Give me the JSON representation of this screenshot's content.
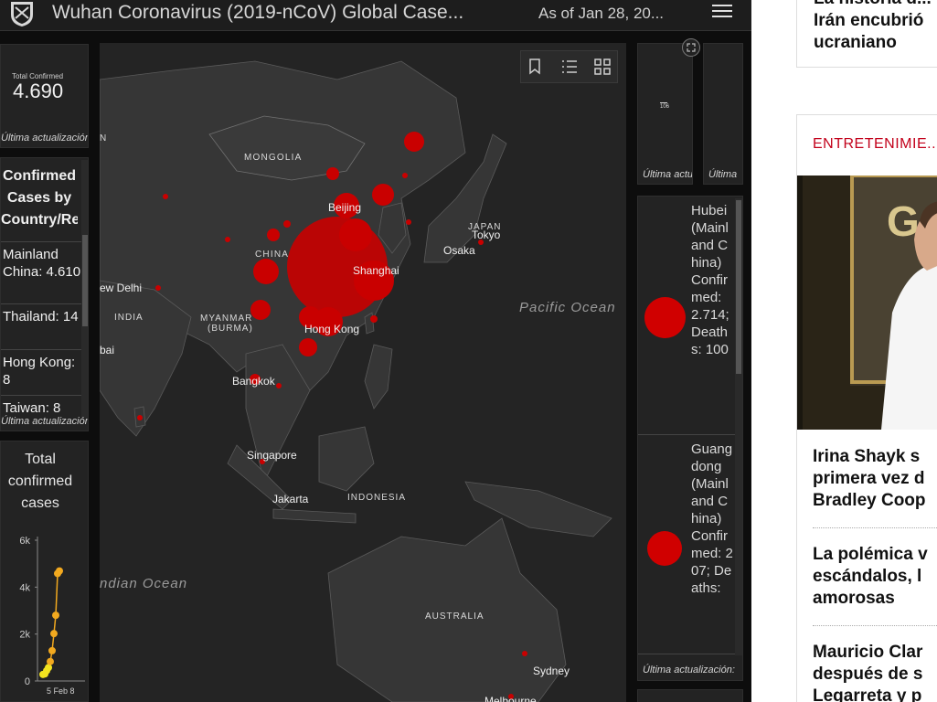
{
  "header": {
    "title": "Wuhan Coronavirus (2019-nCoV) Global Case...",
    "as_of": "As of Jan 28, 20..."
  },
  "total_confirmed": {
    "label": "Total Confirmed",
    "value": "4.690",
    "last_update": "Última actualización"
  },
  "by_country": {
    "heading": "Confirmed Cases by Country/Region",
    "items": [
      {
        "label": "Mainland China: 4.610"
      },
      {
        "label": "Thailand: 14"
      },
      {
        "label": "Hong Kong: 8"
      },
      {
        "label": "Taiwan: 8"
      }
    ],
    "last_update": "Última actualización"
  },
  "chart_panel": {
    "heading": "Total confirmed cases"
  },
  "chart_data": {
    "type": "line",
    "title": "Total confirmed cases",
    "xlabel": "",
    "ylabel": "",
    "ylim": [
      0,
      6000
    ],
    "yticks": [
      "0",
      "2k",
      "4k",
      "6k"
    ],
    "xtick_label": "5 Feb 8",
    "series": [
      {
        "values": [
          280,
          300,
          440,
          570,
          830,
          1290,
          2020,
          2800,
          4580,
          4690
        ]
      }
    ],
    "colors": {
      "points": "#f2a91f",
      "line": "#f2a91f",
      "highlight": "#f2e31f"
    }
  },
  "map": {
    "labels": {
      "mongolia": "MONGOLIA",
      "china": "CHINA",
      "beijing": "Beijing",
      "shanghai": "Shanghai",
      "japan": "JAPAN",
      "tokyo": "Tokyo",
      "osaka": "Osaka",
      "pacific": "Pacific Ocean",
      "new_delhi": "ew Delhi",
      "india": "INDIA",
      "myanmar": "MYANMAR",
      "burma": "(BURMA)",
      "hong_kong": "Hong Kong",
      "bai": "bai",
      "bangkok": "Bangkok",
      "singapore": "Singapore",
      "jakarta": "Jakarta",
      "indonesia": "INDONESIA",
      "indian_ocean": "ndian Ocean",
      "australia": "AUSTRALIA",
      "sydney": "Sydney",
      "melbourne": "Melbourne",
      "n_edge": "N"
    },
    "colors": {
      "case_dot": "#c90000",
      "land": "#363636",
      "water": "#242424",
      "border": "#707070"
    }
  },
  "right_top": {
    "value_label": "106",
    "last_update_1": "Última actu",
    "last_update_2": "Última"
  },
  "province_list": {
    "items": [
      {
        "name": "Hubei",
        "text": "Hubei (Mainland China) Confirmed: 2.714; Deaths: 100"
      },
      {
        "name": "Guangdong",
        "text": "Guangdong (Mainland China) Confirmed: 207; Deaths:"
      }
    ],
    "last_update": "Última actualización:"
  },
  "news": {
    "top_card": {
      "line1": "La historia d...",
      "line2": "Irán encubrió",
      "line3": "ucraniano"
    },
    "section": "ENTRETENIMIE...",
    "headlines": [
      {
        "l1": "Irina Shayk s",
        "l2": "primera vez d",
        "l3": "Bradley Coop"
      },
      {
        "l1": "La polémica v",
        "l2": "escándalos, l",
        "l3": "amorosas"
      },
      {
        "l1": "Mauricio Clar",
        "l2": "después de s",
        "l3": "Legarreta y p"
      }
    ]
  }
}
